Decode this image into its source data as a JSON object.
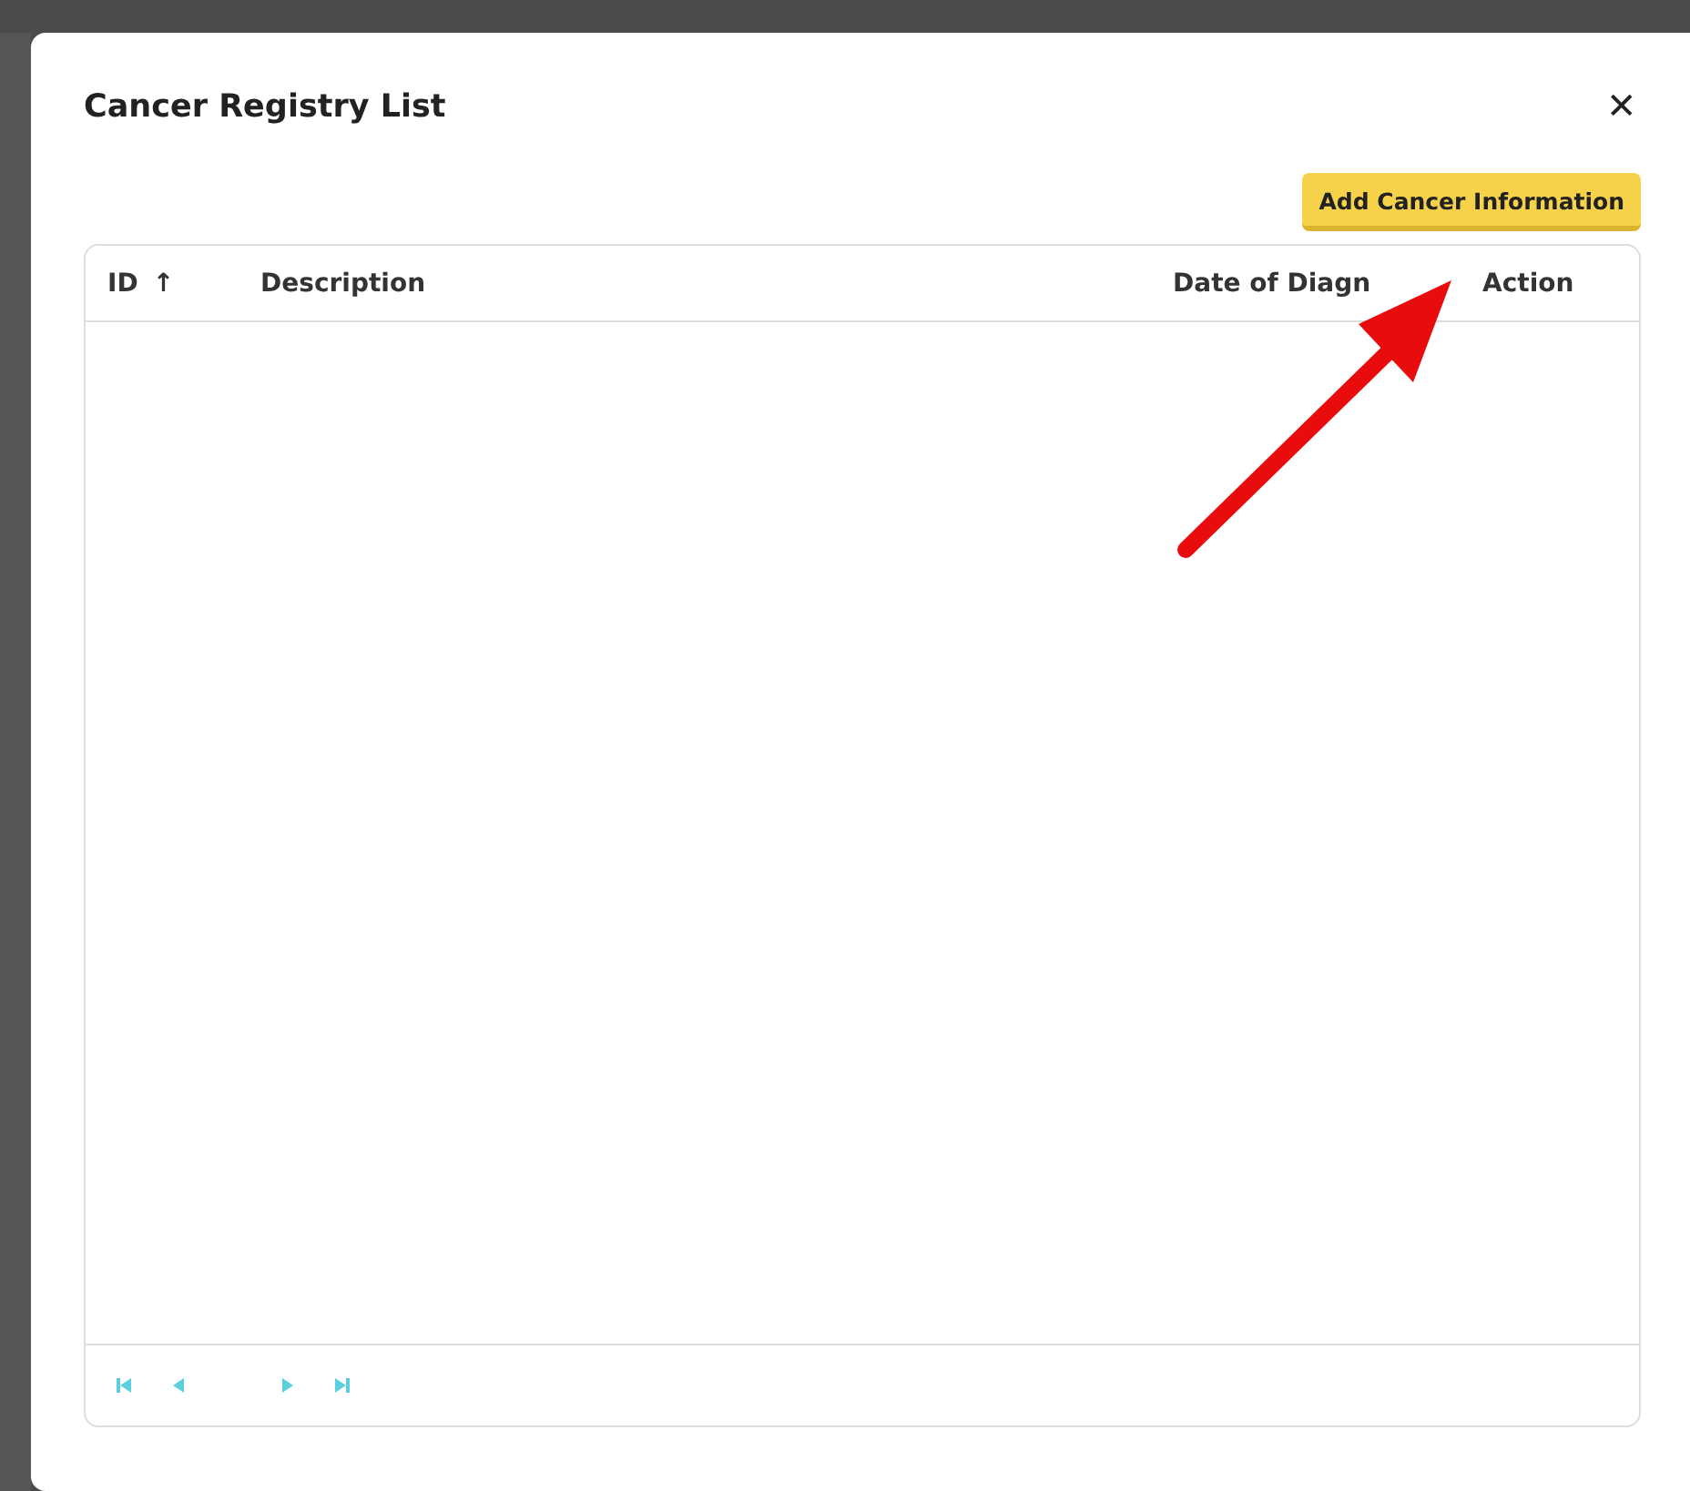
{
  "dialog": {
    "title": "Cancer Registry List",
    "close": "✕"
  },
  "add_button": "Add Cancer Information",
  "table": {
    "columns": [
      {
        "label": "ID",
        "sort_indicator": "↑"
      },
      {
        "label": "Description"
      },
      {
        "label": "Date of Diagn"
      },
      {
        "label": "Action"
      }
    ]
  }
}
